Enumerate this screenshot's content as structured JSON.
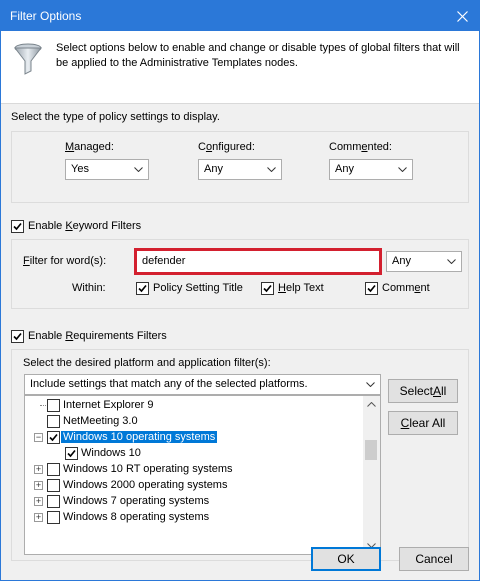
{
  "window": {
    "title": "Filter Options"
  },
  "description": "Select options below to enable and change or disable types of global filters that will be applied to the Administrative Templates nodes.",
  "policy_section": {
    "label": "Select the type of policy settings to display.",
    "managed": {
      "label_u": "M",
      "label_rest": "anaged:",
      "value": "Yes"
    },
    "configured": {
      "label_pre": "C",
      "label_u": "o",
      "label_rest": "nfigured:",
      "value": "Any"
    },
    "commented": {
      "label_pre": "Comm",
      "label_u": "e",
      "label_rest": "nted:",
      "value": "Any"
    }
  },
  "keyword": {
    "checkbox_pre": "Enable ",
    "checkbox_u": "K",
    "checkbox_rest": "eyword Filters",
    "checked": true,
    "filter_label_pre": "",
    "filter_label_u": "F",
    "filter_label_rest": "ilter for word(s):",
    "filter_value": "defender",
    "match_value": "Any",
    "within_label": "Within:",
    "policy_title_label": "Policy Setting Title",
    "help_text_pre": "",
    "help_text_u": "H",
    "help_text_rest": "elp Text",
    "comment_pre": "Comm",
    "comment_u": "e",
    "comment_rest": "nt"
  },
  "requirements": {
    "checkbox_pre": "Enable ",
    "checkbox_u": "R",
    "checkbox_rest": "equirements Filters",
    "checked": true,
    "platform_label": "Select the desired platform and application filter(s):",
    "match_combo": "Include settings that match any of the selected platforms.",
    "select_all_pre": "Select ",
    "select_all_u": "A",
    "select_all_rest": "ll",
    "clear_all_u": "C",
    "clear_all_rest": "lear All",
    "tree_items": [
      {
        "label": "Internet Explorer 9"
      },
      {
        "label": "NetMeeting 3.0"
      },
      {
        "label": "Windows 10 operating systems"
      },
      {
        "label": "Windows 10"
      },
      {
        "label": "Windows 10 RT operating systems"
      },
      {
        "label": "Windows 2000 operating systems"
      },
      {
        "label": "Windows 7 operating systems"
      },
      {
        "label": "Windows 8 operating systems"
      }
    ]
  },
  "footer": {
    "ok": "OK",
    "cancel": "Cancel"
  },
  "colors": {
    "accent": "#2b78d8",
    "selection": "#0078d7",
    "highlight_box": "#d3202f"
  }
}
